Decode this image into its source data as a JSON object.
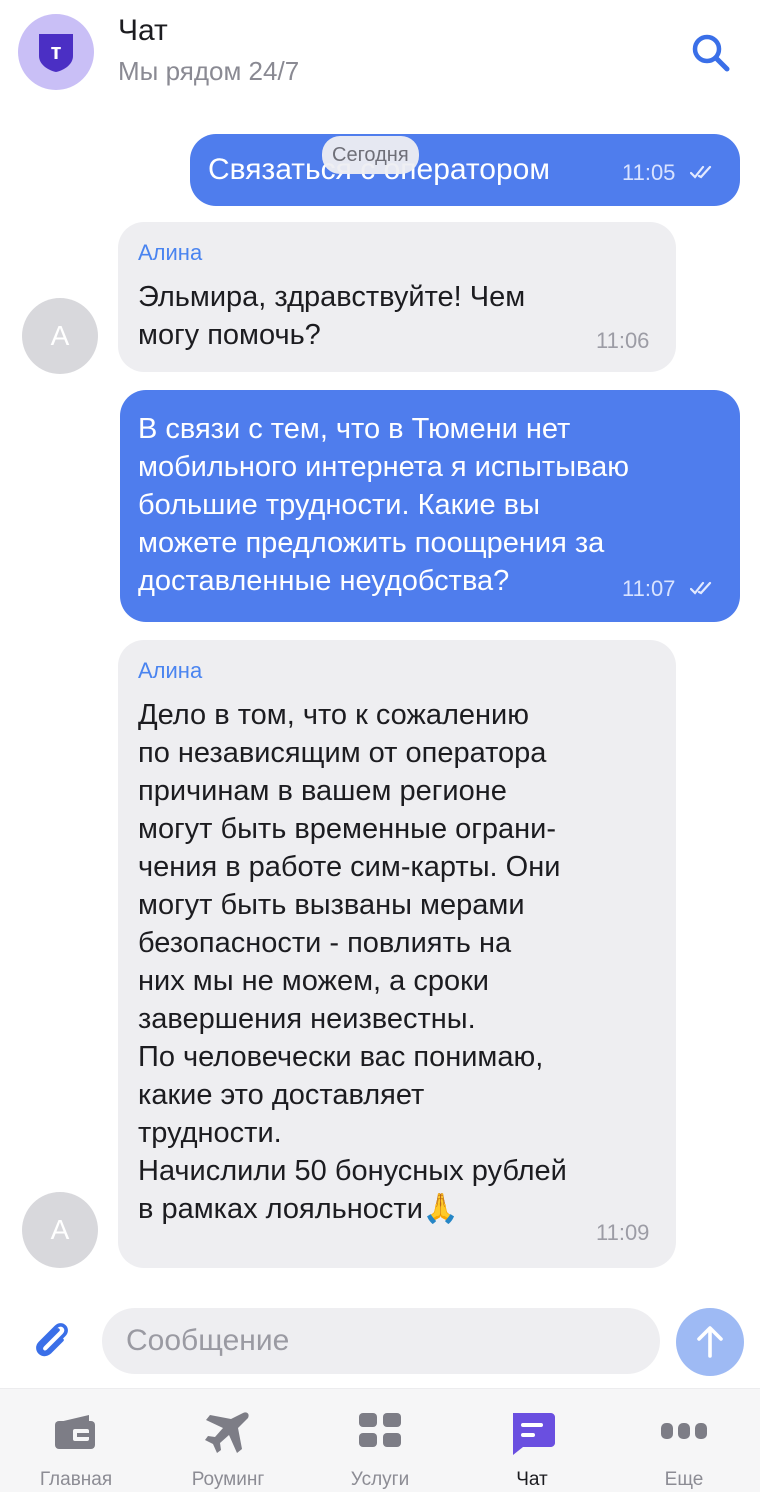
{
  "header": {
    "title": "Чат",
    "subtitle": "Мы рядом 24/7",
    "logo_letter": "т"
  },
  "date_chip": "Сегодня",
  "messages": [
    {
      "direction": "out",
      "text": "Связаться с оператором",
      "time": "11:05",
      "status": "read"
    },
    {
      "direction": "in",
      "author": "Алина",
      "avatar_letter": "А",
      "text": "Эльмира, здравствуйте! Чем\nмогу помочь?",
      "time": "11:06"
    },
    {
      "direction": "out",
      "text": "В связи с тем, что в Тюмени нет\nмобильного интернета я испытываю\nбольшие трудности. Какие вы\nможете предложить поощрения за\nдоставленные неудобства?",
      "time": "11:07",
      "status": "read"
    },
    {
      "direction": "in",
      "author": "Алина",
      "avatar_letter": "А",
      "text": "Дело в том, что к сожалению\nпо независящим от оператора\nпричинам в вашем регионе\nмогут быть временные ограни-\nчения в работе сим-карты. Они\nмогут быть вызваны мерами\nбезопасности - повлиять на\nних мы не можем, а сроки\nзавершения неизвестны.\nПо человечески вас понимаю,\nкакие это доставляет\nтрудности.\nНачислили 50 бонусных рублей\nв рамках лояльности🙏",
      "time": "11:09"
    }
  ],
  "composer": {
    "placeholder": "Сообщение",
    "value": ""
  },
  "tabs": [
    {
      "label": "Главная",
      "icon": "home-card-icon",
      "active": false
    },
    {
      "label": "Роуминг",
      "icon": "airplane-icon",
      "active": false
    },
    {
      "label": "Услуги",
      "icon": "services-grid-icon",
      "active": false
    },
    {
      "label": "Чат",
      "icon": "chat-icon",
      "active": true
    },
    {
      "label": "Еще",
      "icon": "more-dots-icon",
      "active": false
    }
  ],
  "colors": {
    "accent": "#4f7ded",
    "logo_bg": "#c9bff6",
    "logo_fg": "#4b2fc4",
    "incoming_bg": "#eeeef1",
    "active_tab": "#6a4fe0"
  }
}
